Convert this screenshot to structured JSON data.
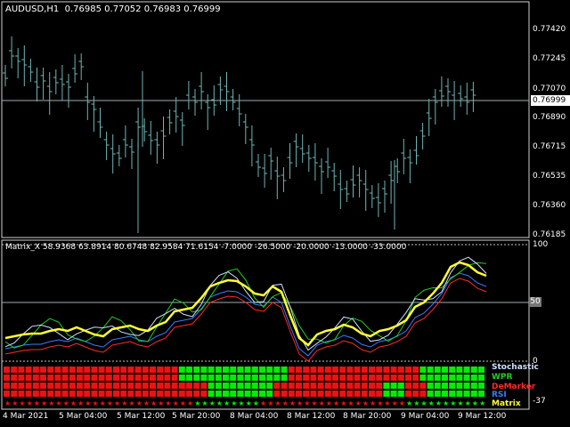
{
  "chart": {
    "header": "AUDUSD,H1  0.76985 0.77052 0.76983 0.76999",
    "current_price": "0.76999",
    "price_ticks": [
      "0.77420",
      "0.77245",
      "0.77070",
      "0.76890",
      "0.76715",
      "0.76535",
      "0.76360",
      "0.76185"
    ]
  },
  "indicator": {
    "header": "Matrix_X 58.9368 63.8914 80.6748 82.9584 71.6154 -7.0000 -26.5000 -20.0000 -13.0000 -33.0000",
    "ticks": [
      "100",
      "0",
      "-37"
    ],
    "level_label": "50",
    "legend": [
      {
        "name": "Stochastic",
        "color": "#cfe0ff"
      },
      {
        "name": "WPR",
        "color": "#22cc22"
      },
      {
        "name": "DeMarker",
        "color": "#ff2a2a"
      },
      {
        "name": "RSI",
        "color": "#3b7bff"
      },
      {
        "name": "Matrix",
        "color": "#ffff33"
      }
    ]
  },
  "time_axis": [
    "4 Mar 2021",
    "5 Mar 04:00",
    "5 Mar 12:00",
    "5 Mar 20:00",
    "8 Mar 04:00",
    "8 Mar 12:00",
    "8 Mar 20:00",
    "9 Mar 04:00",
    "9 Mar 12:00"
  ],
  "colors": {
    "candle": "#6fb5b5",
    "bull": "#00ee00",
    "bear": "#ee1111",
    "grid": "#c0c0c0"
  }
}
